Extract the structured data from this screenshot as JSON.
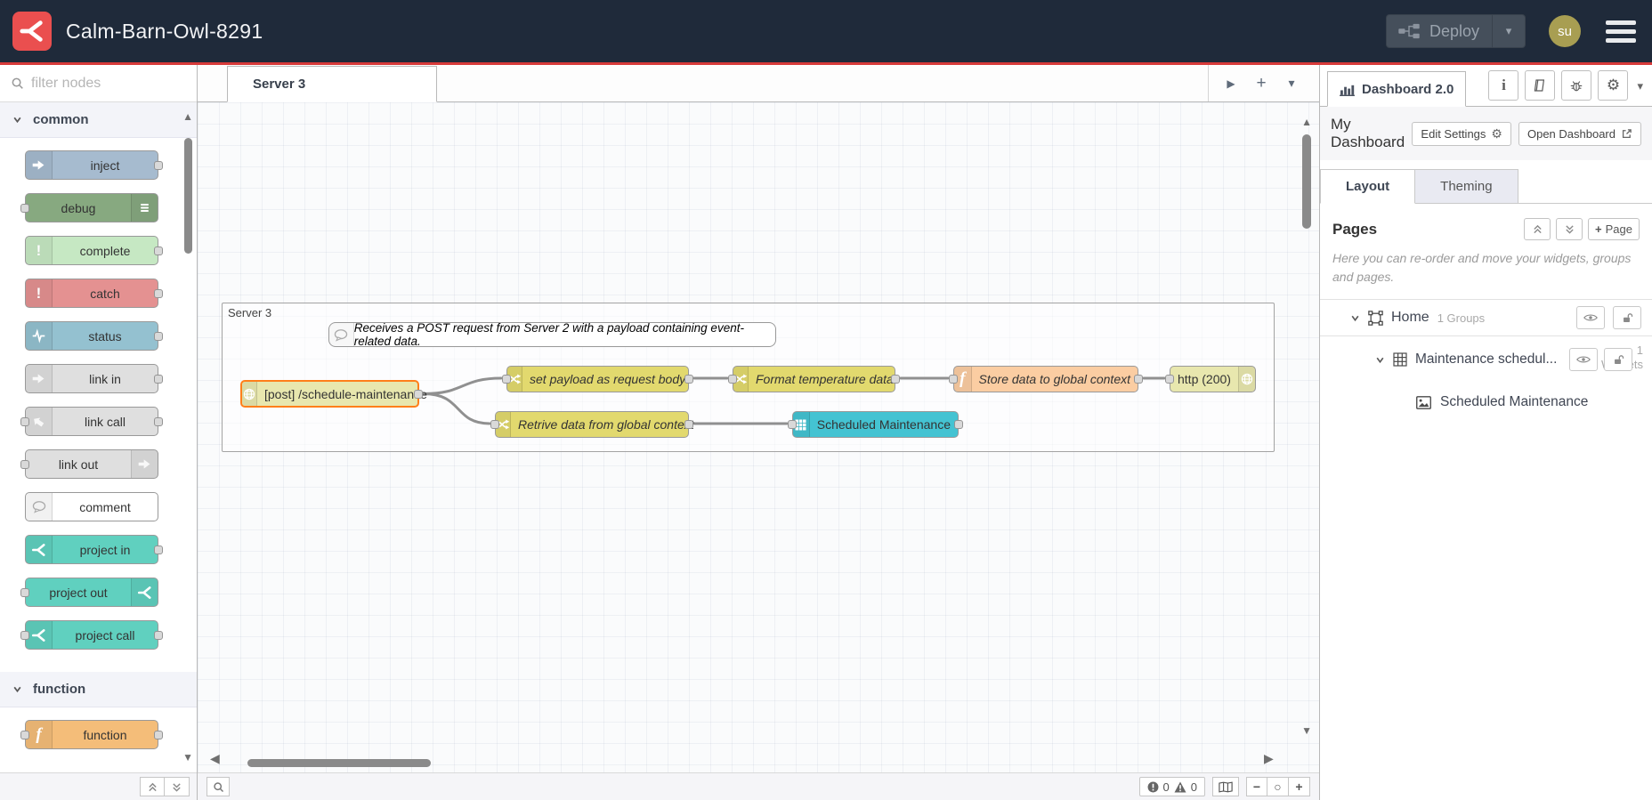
{
  "header": {
    "title": "Calm-Barn-Owl-8291",
    "deploy_label": "Deploy",
    "avatar_text": "su"
  },
  "icons": {
    "play": "▶",
    "plus": "+",
    "caret": "▾",
    "gear": "⚙",
    "minus": "−",
    "circle": "○",
    "left": "◀",
    "right": "▶",
    "up": "▲",
    "down": "▼",
    "excl": "!"
  },
  "colors": {
    "header_bg": "#1f2a3a",
    "accent_red": "#d73a3a",
    "logo_red": "#ea4f4f",
    "selected_orange": "#ff7f1a",
    "avatar_bg": "#a89e52"
  },
  "palette": {
    "filter_placeholder": "filter nodes",
    "categories": [
      {
        "label": "common",
        "nodes": [
          {
            "label": "inject",
            "color": "#a6bbcf"
          },
          {
            "label": "debug",
            "color": "#87a980"
          },
          {
            "label": "complete",
            "color": "#c6e8c3"
          },
          {
            "label": "catch",
            "color": "#e49191"
          },
          {
            "label": "status",
            "color": "#94c1d0"
          },
          {
            "label": "link in",
            "color": "#dfdfdf"
          },
          {
            "label": "link call",
            "color": "#dfdfdf"
          },
          {
            "label": "link out",
            "color": "#dfdfdf"
          },
          {
            "label": "comment",
            "color": "#ffffff"
          },
          {
            "label": "project in",
            "color": "#60d0bf"
          },
          {
            "label": "project out",
            "color": "#60d0bf"
          },
          {
            "label": "project call",
            "color": "#60d0bf"
          }
        ]
      },
      {
        "label": "function",
        "nodes": [
          {
            "label": "function",
            "color": "#f4bd79"
          }
        ]
      }
    ]
  },
  "workspace": {
    "tab_label": "Server 3",
    "group_label": "Server 3",
    "comment_text": "Receives a POST request from Server 2 with a payload containing event-related data.",
    "flow_nodes": {
      "http_in": {
        "label": "[post] /schedule-maintenance",
        "color": "#e8e7ae"
      },
      "set_payload": {
        "label": "set payload as request body",
        "color": "#e2d96e"
      },
      "format_temp": {
        "label": "Format temperature data.",
        "color": "#e2d96e"
      },
      "store_data": {
        "label": "Store data to global context",
        "color": "#fbcda2"
      },
      "http_response": {
        "label": "http (200)",
        "color": "#e8e7ae"
      },
      "retrieve": {
        "label": "Retrive data from global context",
        "color": "#e2d96e"
      },
      "sched_table": {
        "label": "Scheduled Maintenance",
        "color": "#44c3d2"
      }
    },
    "footer": {
      "error_count": "0",
      "warning_count": "0"
    }
  },
  "sidebar": {
    "tab_label": "Dashboard 2.0",
    "dashboard_name": "My Dashboard",
    "edit_settings_label": "Edit Settings",
    "open_dashboard_label": "Open Dashboard",
    "tabs": {
      "layout": "Layout",
      "theming": "Theming"
    },
    "pages_heading": "Pages",
    "page_button_label": "Page",
    "help_text": "Here you can re-order and move your widgets, groups and pages.",
    "tree": {
      "home": {
        "label": "Home",
        "badge": "1 Groups"
      },
      "maintenance": {
        "label": "Maintenance schedul...",
        "badge_line1": "1",
        "badge_line2": "Widgets"
      },
      "widget": {
        "label": "Scheduled Maintenance"
      }
    }
  }
}
